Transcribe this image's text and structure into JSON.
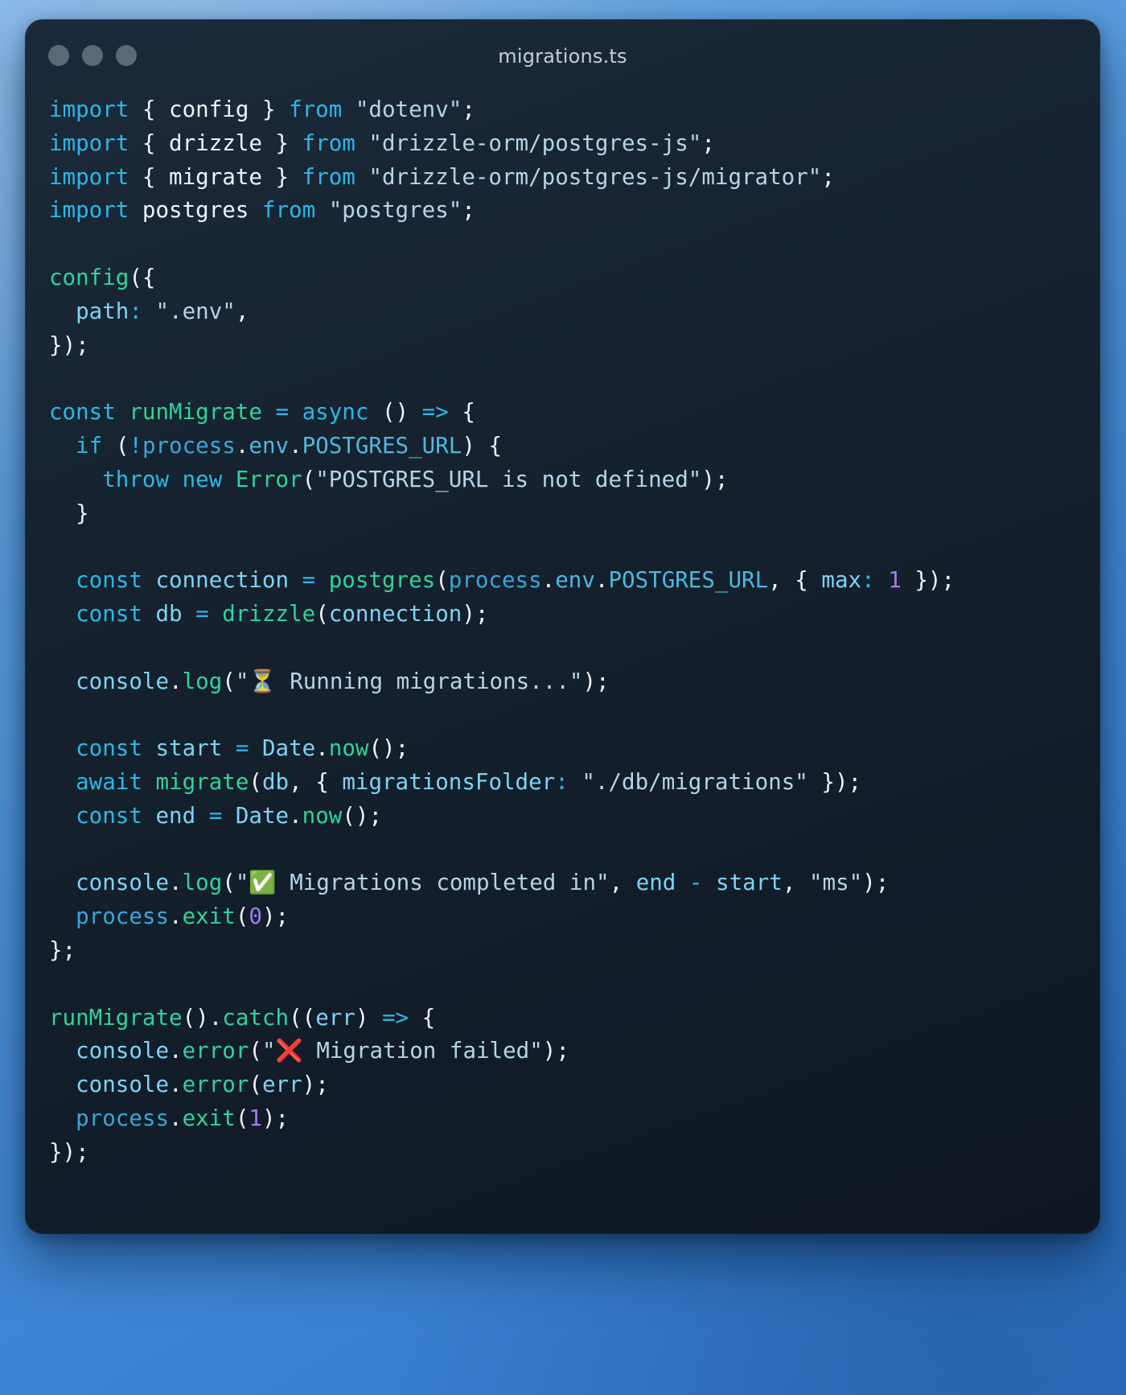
{
  "window": {
    "title": "migrations.ts",
    "traffic_lights": [
      "close-button",
      "minimize-button",
      "zoom-button"
    ],
    "background_color": "#16222f",
    "wallpaper_color": "#4a90d9"
  },
  "theme": {
    "keyword": "#2bb8e8",
    "function": "#2fd49a",
    "variable": "#7fd3f7",
    "property": "#4fb8e0",
    "string": "#b6d4e8",
    "number": "#a57bf0",
    "plain": "#eef3f8"
  },
  "code": {
    "language": "typescript",
    "filename": "migrations.ts",
    "lines": [
      "import { config } from \"dotenv\";",
      "import { drizzle } from \"drizzle-orm/postgres-js\";",
      "import { migrate } from \"drizzle-orm/postgres-js/migrator\";",
      "import postgres from \"postgres\";",
      "",
      "config({",
      "  path: \".env\",",
      "});",
      "",
      "const runMigrate = async () => {",
      "  if (!process.env.POSTGRES_URL) {",
      "    throw new Error(\"POSTGRES_URL is not defined\");",
      "  }",
      "",
      "  const connection = postgres(process.env.POSTGRES_URL, { max: 1 });",
      "  const db = drizzle(connection);",
      "",
      "  console.log(\"⏳ Running migrations...\");",
      "",
      "  const start = Date.now();",
      "  await migrate(db, { migrationsFolder: \"./db/migrations\" });",
      "  const end = Date.now();",
      "",
      "  console.log(\"✅ Migrations completed in\", end - start, \"ms\");",
      "  process.exit(0);",
      "};",
      "",
      "runMigrate().catch((err) => {",
      "  console.error(\"❌ Migration failed\");",
      "  console.error(err);",
      "  process.exit(1);",
      "});"
    ],
    "emojis": {
      "hourglass": "⏳",
      "check": "✅",
      "cross": "❌"
    },
    "imports": [
      {
        "named": "config",
        "module": "dotenv"
      },
      {
        "named": "drizzle",
        "module": "drizzle-orm/postgres-js"
      },
      {
        "named": "migrate",
        "module": "drizzle-orm/postgres-js/migrator"
      },
      {
        "named": "postgres",
        "module": "postgres"
      }
    ],
    "env_var": "POSTGRES_URL",
    "migrations_folder": "./db/migrations",
    "dotenv_path": ".env",
    "max_connections": "1",
    "exit_success": "0",
    "exit_failure": "1"
  }
}
